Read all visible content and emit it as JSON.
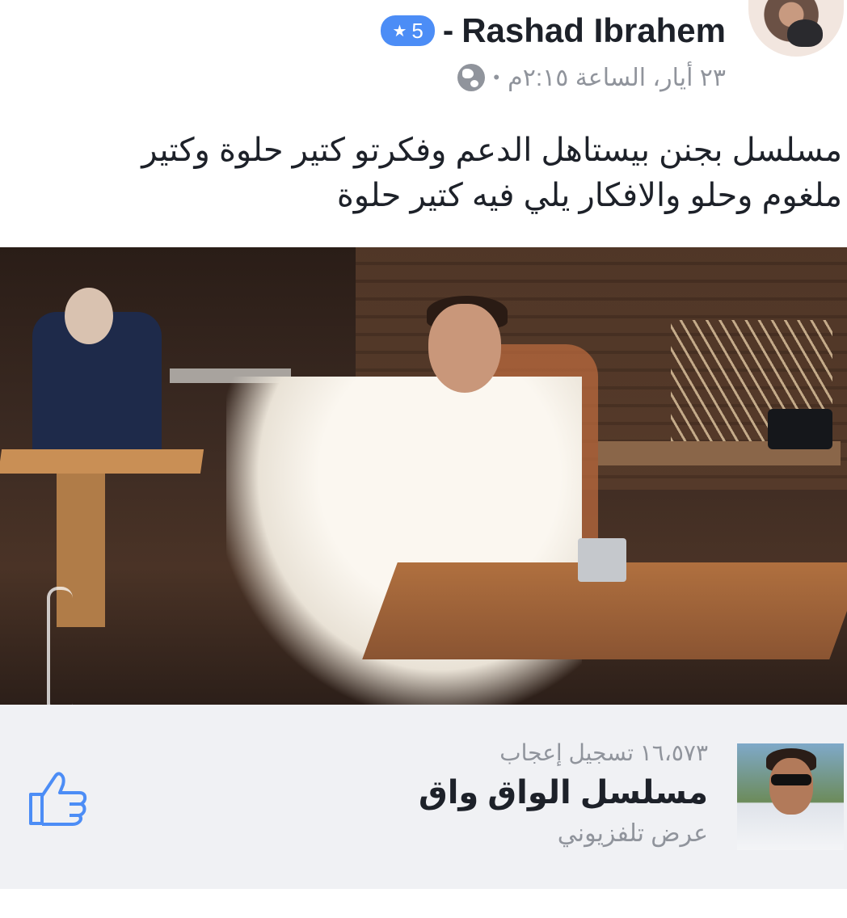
{
  "post": {
    "author": "Rashad Ibrahem",
    "separator": "-",
    "badge": {
      "icon": "star-icon",
      "count": "5"
    },
    "timestamp": "٢٣ أيار، الساعة ٢:١٥م",
    "meta_separator": "•",
    "privacy_icon": "globe-icon",
    "text_line1": "مسلسل بجنن بيستاهل الدعم وفكرتو كتير حلوة وكتير",
    "text_line2": "ملغوم وحلو والافكار يلي فيه كتير حلوة",
    "image": "tv-series-still-photo"
  },
  "page_card": {
    "likes": "١٦،٥٧٣ تسجيل إعجاب",
    "name": "مسلسل الواق واق",
    "category": "عرض تلفزيوني",
    "like_icon": "thumbs-up-icon"
  },
  "colors": {
    "badge_blue": "#4c8df6",
    "like_blue": "#4c8df6",
    "muted_text": "#90949c",
    "card_background": "#f0f1f4"
  }
}
